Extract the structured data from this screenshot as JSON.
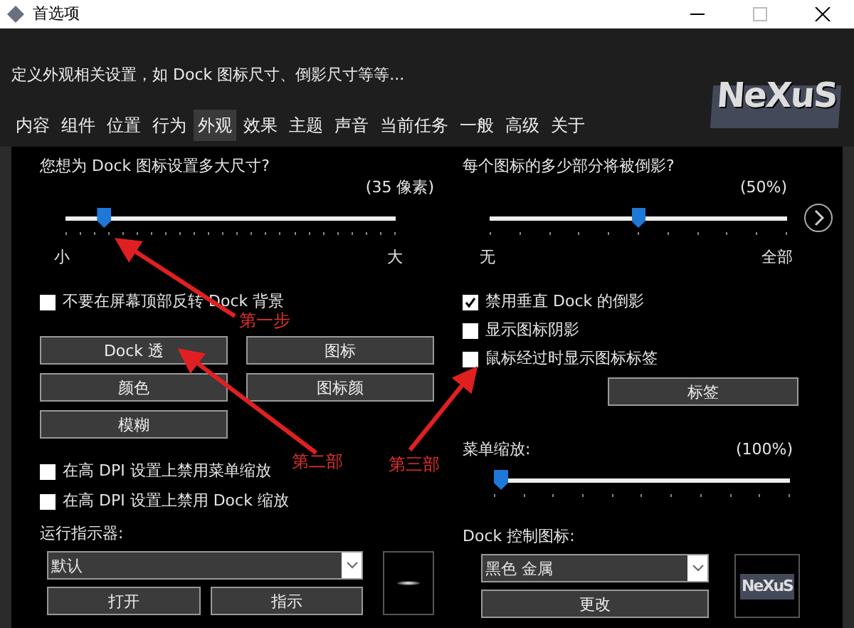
{
  "window": {
    "title": "首选项"
  },
  "header": {
    "description": "定义外观相关设置，如 Dock 图标尺寸、倒影尺寸等等...",
    "logo": "NeXuS"
  },
  "tabs": [
    {
      "label": "内容",
      "selected": false
    },
    {
      "label": "组件",
      "selected": false
    },
    {
      "label": "位置",
      "selected": false
    },
    {
      "label": "行为",
      "selected": false
    },
    {
      "label": "外观",
      "selected": true
    },
    {
      "label": "效果",
      "selected": false
    },
    {
      "label": "主题",
      "selected": false
    },
    {
      "label": "声音",
      "selected": false
    },
    {
      "label": "当前任务",
      "selected": false
    },
    {
      "label": "一般",
      "selected": false
    },
    {
      "label": "高级",
      "selected": false
    },
    {
      "label": "关于",
      "selected": false
    }
  ],
  "left": {
    "size_slider": {
      "question": "您想为 Dock 图标设置多大尺寸?",
      "reading": "(35 像素)",
      "level": 0.1,
      "min_label": "小",
      "max_label": "大"
    },
    "flip_checkbox": {
      "label": "不要在屏幕顶部反转 Dock 背景",
      "checked": false
    },
    "buttons": [
      "Dock 透",
      "图标",
      "颜色",
      "图标颜",
      "模糊"
    ],
    "dpi_checkboxes": [
      {
        "label": "在高 DPI 设置上禁用菜单缩放",
        "checked": false
      },
      {
        "label": "在高 DPI 设置上禁用 Dock 缩放",
        "checked": false
      }
    ],
    "indicator": {
      "label": "运行指示器:",
      "value": "默认",
      "buttons": [
        "打开",
        "指示"
      ]
    }
  },
  "right": {
    "reflection_slider": {
      "question": "每个图标的多少部分将被倒影?",
      "reading": "(50%)",
      "level": 0.5,
      "min_label": "无",
      "max_label": "全部"
    },
    "checkboxes": [
      {
        "label": "禁用垂直 Dock 的倒影",
        "checked": true
      },
      {
        "label": "显示图标阴影",
        "checked": false
      },
      {
        "label": "鼠标经过时显示图标标签",
        "checked": false
      }
    ],
    "label_button": "标签",
    "menu_scale": {
      "label": "菜单缩放:",
      "reading": "(100%)",
      "level": 0.0
    },
    "control_icon": {
      "label": "Dock 控制图标:",
      "value": "黑色 金属",
      "button": "更改",
      "preview_logo": "NeXuS"
    }
  },
  "annotations": [
    {
      "text": "第一步"
    },
    {
      "text": "第二部"
    },
    {
      "text": "第三部"
    }
  ]
}
